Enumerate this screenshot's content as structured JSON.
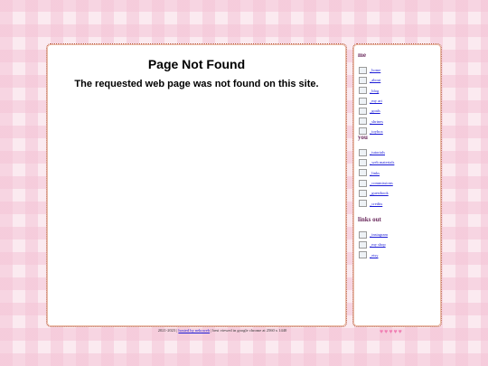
{
  "main": {
    "title": "Page Not Found",
    "subtitle": "The requested web page was not found on this site."
  },
  "sidebar": {
    "me_heading": "me",
    "me_links": [
      "_home",
      "_about",
      "_blog",
      "_my art",
      "_goals",
      "_shrines",
      "_toybox"
    ],
    "you_heading": "you",
    "you_links": [
      "_tutorials",
      "_web materials",
      "_links",
      "_commissions",
      "_guestbook",
      "_credits"
    ],
    "out_heading": "links out",
    "out_links": [
      "_instagram",
      "_my shop",
      "_etsy"
    ]
  },
  "footer": {
    "prefix": "2021-2023 |",
    "link": "hosted by nekoweb",
    "suffix": "| best viewed in google chrome at 2560 x 1440"
  },
  "hearts": [
    "heart-icon",
    "heart-icon",
    "heart-icon",
    "heart-icon",
    "heart-icon"
  ],
  "colors": {
    "background_pink": "#fbeaf0",
    "border_brown": "#b4442c",
    "heading_purple": "#6b2a5d",
    "link_blue": "#1a1ad6",
    "heart_pink": "#f07fb3"
  }
}
